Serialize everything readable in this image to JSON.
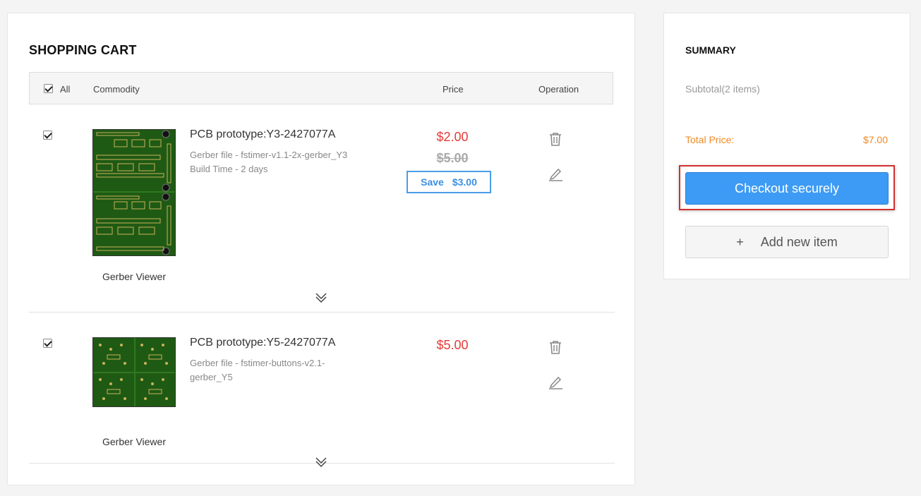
{
  "cart": {
    "title": "SHOPPING CART",
    "header": {
      "all": "All",
      "commodity": "Commodity",
      "price": "Price",
      "operation": "Operation"
    },
    "items": [
      {
        "title": "PCB prototype:Y3-2427077A",
        "meta1": "Gerber file - fstimer-v1.1-2x-gerber_Y3",
        "meta2": "Build Time - 2 days",
        "price": "$2.00",
        "old_price": "$5.00",
        "save_label": "Save",
        "save_amount": "$3.00",
        "viewer": "Gerber Viewer",
        "checked": true
      },
      {
        "title": "PCB prototype:Y5-2427077A",
        "meta1": "Gerber file - fstimer-buttons-v2.1-gerber_Y5",
        "price": "$5.00",
        "viewer": "Gerber Viewer",
        "checked": true
      }
    ]
  },
  "summary": {
    "title": "SUMMARY",
    "subtotal": "Subtotal(2 items)",
    "total_label": "Total Price:",
    "total_value": "$7.00",
    "checkout_label": "Checkout securely",
    "add_plus": "+",
    "add_label": "Add new item"
  },
  "colors": {
    "accent_blue": "#3d9bf5",
    "price_red": "#e53935",
    "total_orange": "#f08a24",
    "highlight_red": "#d32f2f",
    "pcb_green": "#1f5a14"
  }
}
